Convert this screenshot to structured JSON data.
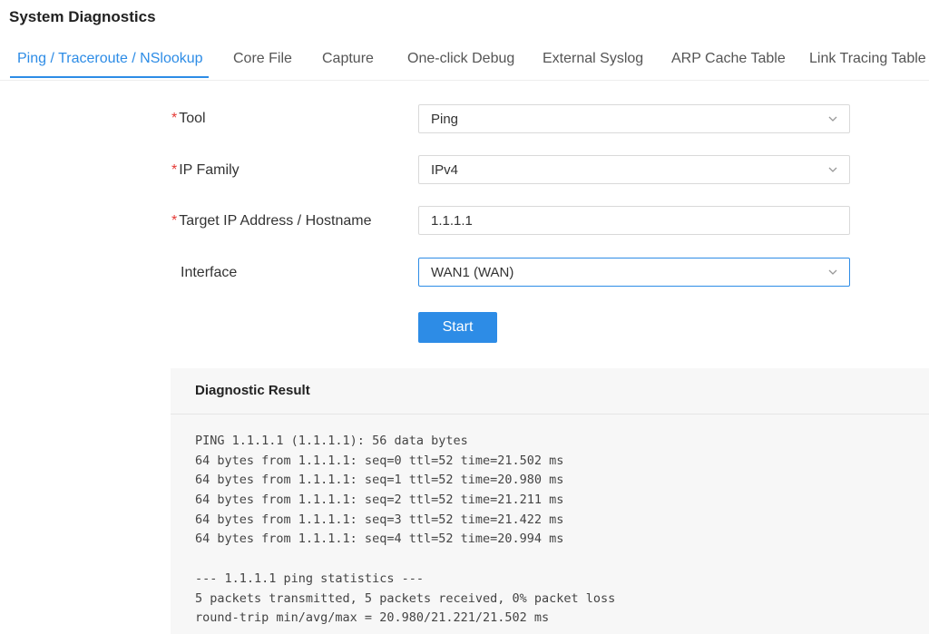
{
  "page": {
    "title": "System Diagnostics"
  },
  "tabs": [
    {
      "label": "Ping / Traceroute / NSlookup",
      "active": true
    },
    {
      "label": "Core File",
      "active": false
    },
    {
      "label": "Capture",
      "active": false
    },
    {
      "label": "One-click Debug",
      "active": false
    },
    {
      "label": "External Syslog",
      "active": false
    },
    {
      "label": "ARP Cache Table",
      "active": false
    },
    {
      "label": "Link Tracing Table",
      "active": false
    }
  ],
  "form": {
    "required_mark": "*",
    "tool": {
      "label": "Tool",
      "value": "Ping"
    },
    "ip_family": {
      "label": "IP Family",
      "value": "IPv4"
    },
    "target": {
      "label": "Target IP Address / Hostname",
      "value": "1.1.1.1"
    },
    "interface": {
      "label": "Interface",
      "value": "WAN1 (WAN)"
    },
    "start_label": "Start"
  },
  "result": {
    "title": "Diagnostic Result",
    "lines": [
      "PING 1.1.1.1 (1.1.1.1): 56 data bytes",
      "64 bytes from 1.1.1.1: seq=0 ttl=52 time=21.502 ms",
      "64 bytes from 1.1.1.1: seq=1 ttl=52 time=20.980 ms",
      "64 bytes from 1.1.1.1: seq=2 ttl=52 time=21.211 ms",
      "64 bytes from 1.1.1.1: seq=3 ttl=52 time=21.422 ms",
      "64 bytes from 1.1.1.1: seq=4 ttl=52 time=20.994 ms",
      "",
      "--- 1.1.1.1 ping statistics ---",
      "5 packets transmitted, 5 packets received, 0% packet loss",
      "round-trip min/avg/max = 20.980/21.221/21.502 ms"
    ]
  },
  "colors": {
    "accent": "#2d8ce6",
    "required": "#e53935",
    "panel_bg": "#f7f7f7"
  },
  "icons": {
    "dropdown": "chevron-down-icon"
  }
}
